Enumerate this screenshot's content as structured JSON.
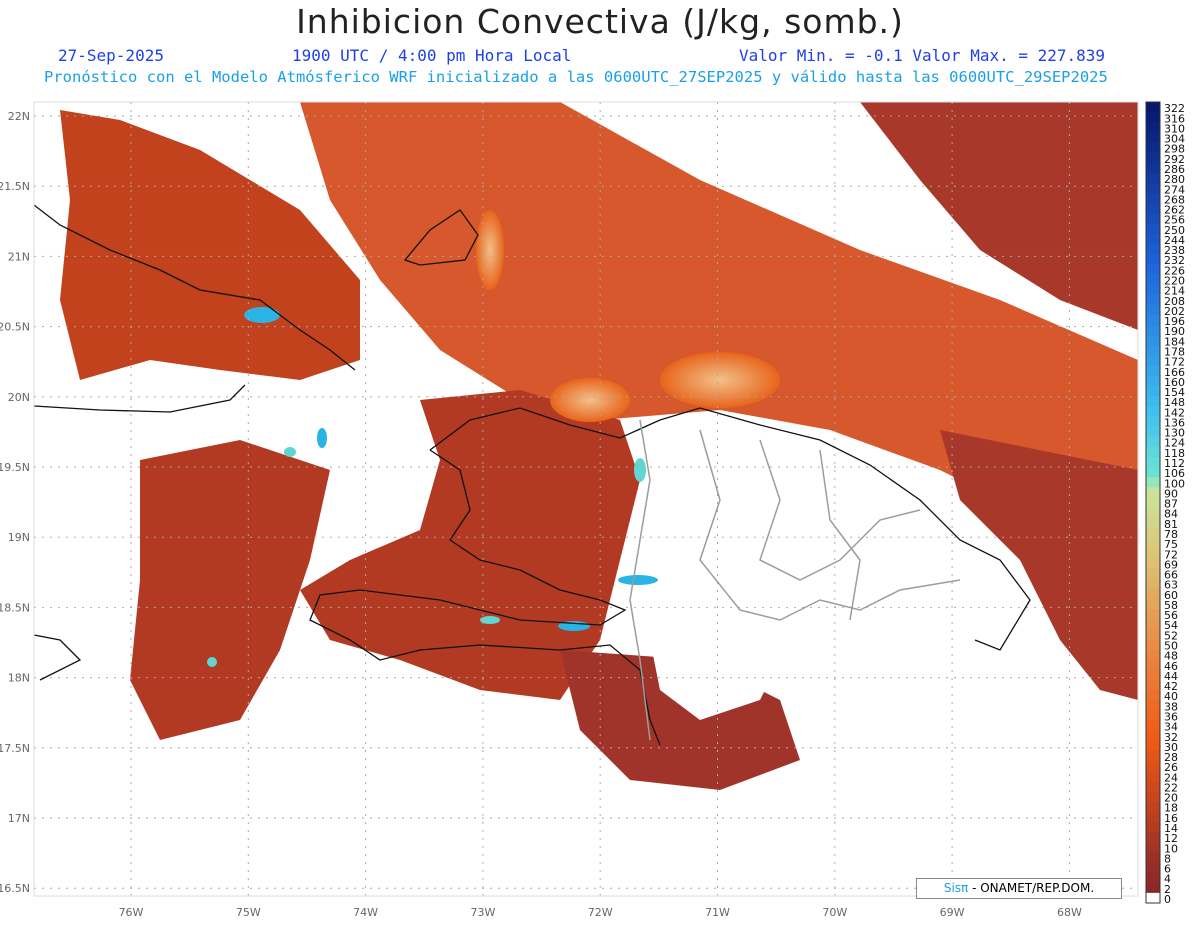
{
  "header": {
    "title": "Inhibicion Convectiva (J/kg, somb.)",
    "date": "27-Sep-2025",
    "time": "1900 UTC / 4:00 pm Hora Local",
    "min_max": "Valor Min. = -0.1  Valor Max. = 227.839",
    "forecast_note": "Pronóstico con el Modelo Atmósferico WRF inicializado a las 0600UTC_27SEP2025 y válido hasta las  0600UTC_29SEP2025"
  },
  "map": {
    "lat_labels": [
      "22N",
      "21.5N",
      "21N",
      "20.5N",
      "20N",
      "19.5N",
      "19N",
      "18.5N",
      "18N",
      "17.5N",
      "17N",
      "16.5N"
    ],
    "lon_labels": [
      "76W",
      "75W",
      "74W",
      "73W",
      "72W",
      "71W",
      "70W",
      "69W",
      "68W"
    ],
    "lat_values": [
      22,
      21.5,
      21,
      20.5,
      20,
      19.5,
      19,
      18.5,
      18,
      17.5,
      17,
      16.5
    ],
    "lon_values": [
      -76,
      -75,
      -74,
      -73,
      -72,
      -71,
      -70,
      -69,
      -68
    ],
    "field_colors": {
      "low": "#a0342a",
      "mid": "#e8641c",
      "high": "#f0b67a",
      "peak": "#2ab4e6"
    }
  },
  "colorbar": {
    "labels": [
      "322",
      "316",
      "310",
      "304",
      "298",
      "292",
      "286",
      "280",
      "274",
      "268",
      "262",
      "256",
      "250",
      "244",
      "238",
      "232",
      "226",
      "220",
      "214",
      "208",
      "202",
      "196",
      "190",
      "184",
      "178",
      "172",
      "166",
      "160",
      "154",
      "148",
      "142",
      "136",
      "130",
      "124",
      "118",
      "112",
      "106",
      "100",
      "90",
      "87",
      "84",
      "81",
      "78",
      "75",
      "72",
      "69",
      "66",
      "63",
      "60",
      "58",
      "56",
      "54",
      "52",
      "50",
      "48",
      "46",
      "44",
      "42",
      "40",
      "38",
      "36",
      "34",
      "32",
      "30",
      "28",
      "26",
      "24",
      "22",
      "20",
      "18",
      "16",
      "14",
      "12",
      "10",
      "8",
      "6",
      "4",
      "2",
      "0"
    ]
  },
  "credit": {
    "logo_text": "Sis",
    "logo_pi": "π",
    "text": " - ONAMET/REP.DOM."
  }
}
